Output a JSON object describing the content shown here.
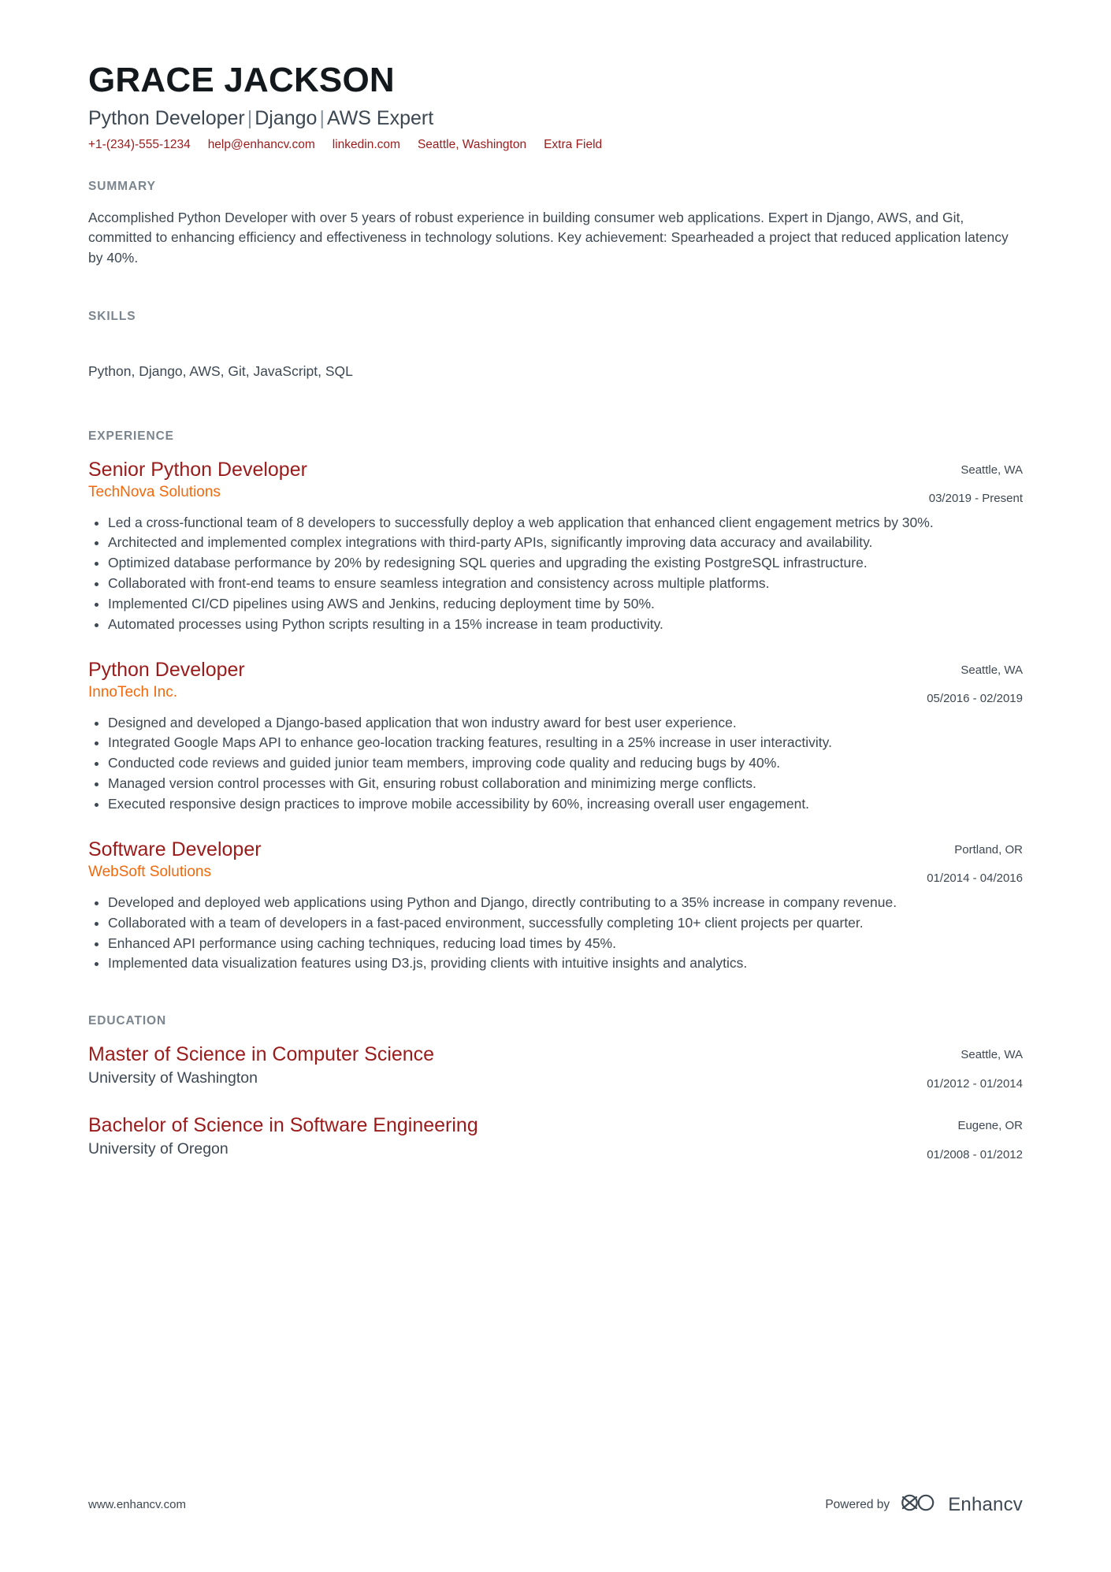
{
  "header": {
    "name": "GRACE JACKSON",
    "headline_parts": [
      "Python Developer",
      "Django",
      "AWS Expert"
    ],
    "headline_separator": "|",
    "contacts": [
      {
        "icon": "phone-icon",
        "label": "+1-(234)-555-1234"
      },
      {
        "icon": "mail-icon",
        "label": "help@enhancv.com"
      },
      {
        "icon": "link-icon",
        "label": "linkedin.com"
      },
      {
        "icon": "location-icon",
        "label": "Seattle, Washington"
      },
      {
        "icon": "info-icon",
        "label": "Extra Field"
      }
    ]
  },
  "summary": {
    "title": "SUMMARY",
    "text": "Accomplished Python Developer with over 5 years of robust experience in building consumer web applications. Expert in Django, AWS, and Git, committed to enhancing efficiency and effectiveness in technology solutions. Key achievement: Spearheaded a project that reduced application latency by 40%."
  },
  "skills": {
    "title": "SKILLS",
    "text": "Python, Django, AWS, Git, JavaScript, SQL"
  },
  "experience": {
    "title": "EXPERIENCE",
    "entries": [
      {
        "role": "Senior Python Developer",
        "company": "TechNova Solutions",
        "location": "Seattle, WA",
        "dates": "03/2019 - Present",
        "bullets": [
          "Led a cross-functional team of 8 developers to successfully deploy a web application that enhanced client engagement metrics by 30%.",
          "Architected and implemented complex integrations with third-party APIs, significantly improving data accuracy and availability.",
          "Optimized database performance by 20% by redesigning SQL queries and upgrading the existing PostgreSQL infrastructure.",
          "Collaborated with front-end teams to ensure seamless integration and consistency across multiple platforms.",
          "Implemented CI/CD pipelines using AWS and Jenkins, reducing deployment time by 50%.",
          "Automated processes using Python scripts resulting in a 15% increase in team productivity."
        ]
      },
      {
        "role": "Python Developer",
        "company": "InnoTech Inc.",
        "location": "Seattle, WA",
        "dates": "05/2016 - 02/2019",
        "bullets": [
          "Designed and developed a Django-based application that won industry award for best user experience.",
          "Integrated Google Maps API to enhance geo-location tracking features, resulting in a 25% increase in user interactivity.",
          "Conducted code reviews and guided junior team members, improving code quality and reducing bugs by 40%.",
          "Managed version control processes with Git, ensuring robust collaboration and minimizing merge conflicts.",
          "Executed responsive design practices to improve mobile accessibility by 60%, increasing overall user engagement."
        ]
      },
      {
        "role": "Software Developer",
        "company": "WebSoft Solutions",
        "location": "Portland, OR",
        "dates": "01/2014 - 04/2016",
        "bullets": [
          "Developed and deployed web applications using Python and Django, directly contributing to a 35% increase in company revenue.",
          "Collaborated with a team of developers in a fast-paced environment, successfully completing 10+ client projects per quarter.",
          "Enhanced API performance using caching techniques, reducing load times by 45%.",
          "Implemented data visualization features using D3.js, providing clients with intuitive insights and analytics."
        ]
      }
    ]
  },
  "education": {
    "title": "EDUCATION",
    "entries": [
      {
        "degree": "Master of Science in Computer Science",
        "school": "University of Washington",
        "location": "Seattle, WA",
        "dates": "01/2012 - 01/2014"
      },
      {
        "degree": "Bachelor of Science in Software Engineering",
        "school": "University of Oregon",
        "location": "Eugene, OR",
        "dates": "01/2008 - 01/2012"
      }
    ]
  },
  "footer": {
    "website": "www.enhancv.com",
    "powered_by": "Powered by",
    "brand": "Enhancv"
  },
  "colors": {
    "accent_dark_red": "#9b1b1b",
    "accent_orange": "#f2680c",
    "body_text": "#3d4852",
    "section_label": "#7b858e",
    "name_text": "#13181d"
  }
}
